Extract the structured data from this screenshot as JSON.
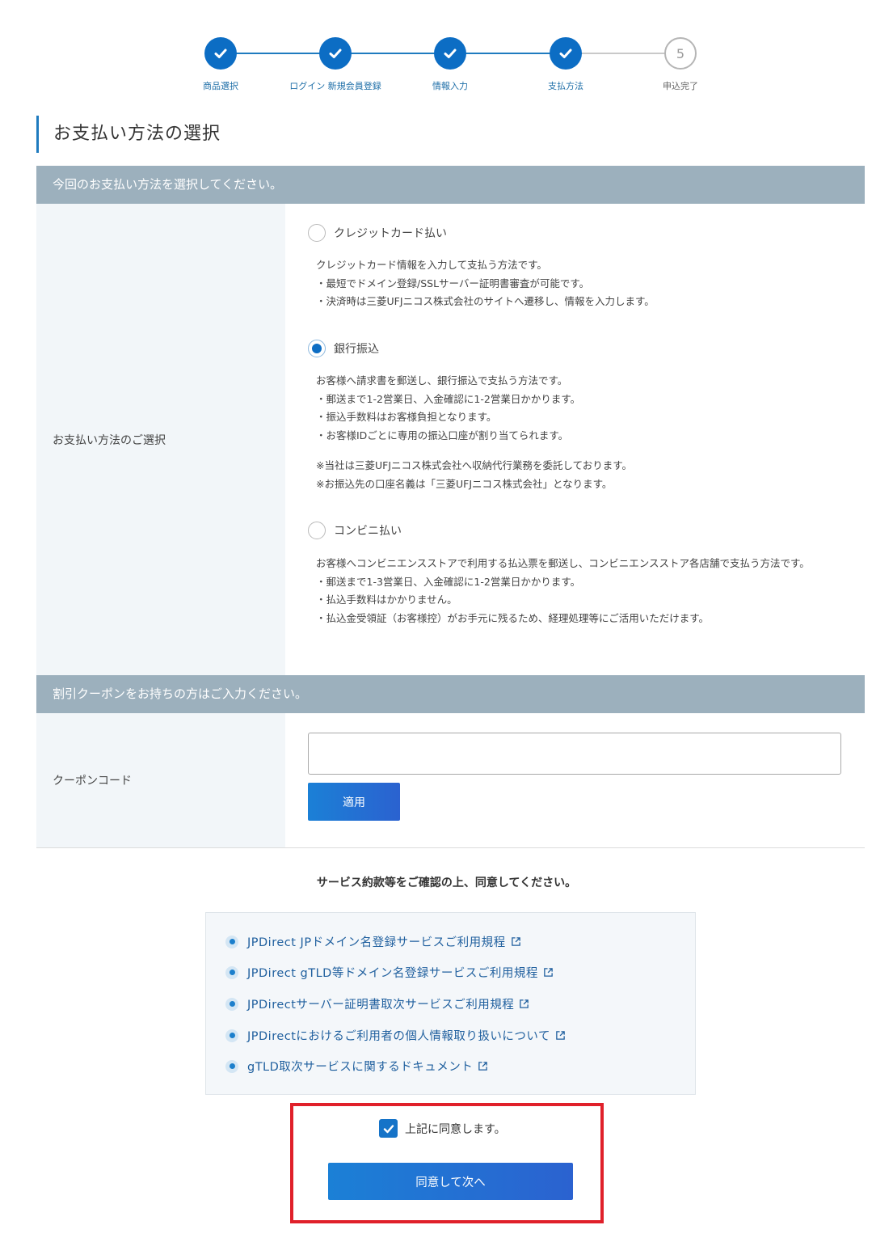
{
  "stepper": {
    "steps": [
      {
        "label": "商品選択",
        "state": "done"
      },
      {
        "label": "ログイン 新規会員登録",
        "state": "done"
      },
      {
        "label": "情報入力",
        "state": "done"
      },
      {
        "label": "支払方法",
        "state": "done"
      },
      {
        "label": "申込完了",
        "state": "pending",
        "number": "5"
      }
    ]
  },
  "page_title": "お支払い方法の選択",
  "payment_section": {
    "header": "今回のお支払い方法を選択してください。",
    "label": "お支払い方法のご選択",
    "options": [
      {
        "label": "クレジットカード払い",
        "selected": false,
        "desc": [
          "クレジットカード情報を入力して支払う方法です。",
          "・最短でドメイン登録/SSLサーバー証明書審査が可能です。",
          "・決済時は三菱UFJニコス株式会社のサイトへ遷移し、情報を入力します。"
        ]
      },
      {
        "label": "銀行振込",
        "selected": true,
        "desc": [
          "お客様へ請求書を郵送し、銀行振込で支払う方法です。",
          "・郵送まで1-2営業日、入金確認に1-2営業日かかります。",
          "・振込手数料はお客様負担となります。",
          "・お客様IDごとに専用の振込口座が割り当てられます。"
        ],
        "notes": [
          "※当社は三菱UFJニコス株式会社へ収納代行業務を委託しております。",
          "※お振込先の口座名義は「三菱UFJニコス株式会社」となります。"
        ]
      },
      {
        "label": "コンビニ払い",
        "selected": false,
        "desc": [
          "お客様へコンビニエンスストアで利用する払込票を郵送し、コンビニエンスストア各店舗で支払う方法です。",
          "・郵送まで1-3営業日、入金確認に1-2営業日かかります。",
          "・払込手数料はかかりません。",
          "・払込金受領証（お客様控）がお手元に残るため、経理処理等にご活用いただけます。"
        ]
      }
    ]
  },
  "coupon_section": {
    "header": "割引クーポンをお持ちの方はご入力ください。",
    "label": "クーポンコード",
    "input_value": "",
    "apply_label": "適用"
  },
  "terms": {
    "heading": "サービス約款等をご確認の上、同意してください。",
    "links": [
      "JPDirect JPドメイン名登録サービスご利用規程",
      "JPDirect gTLD等ドメイン名登録サービスご利用規程",
      "JPDirectサーバー証明書取次サービスご利用規程",
      "JPDirectにおけるご利用者の個人情報取り扱いについて",
      "gTLD取次サービスに関するドキュメント"
    ]
  },
  "agreement": {
    "checkbox_label": "上記に同意します。",
    "checked": true,
    "next_label": "同意して次へ"
  },
  "colors": {
    "primary": "#0c6dc4",
    "header_bar": "#9cb0bd",
    "highlight": "#e0202a"
  }
}
